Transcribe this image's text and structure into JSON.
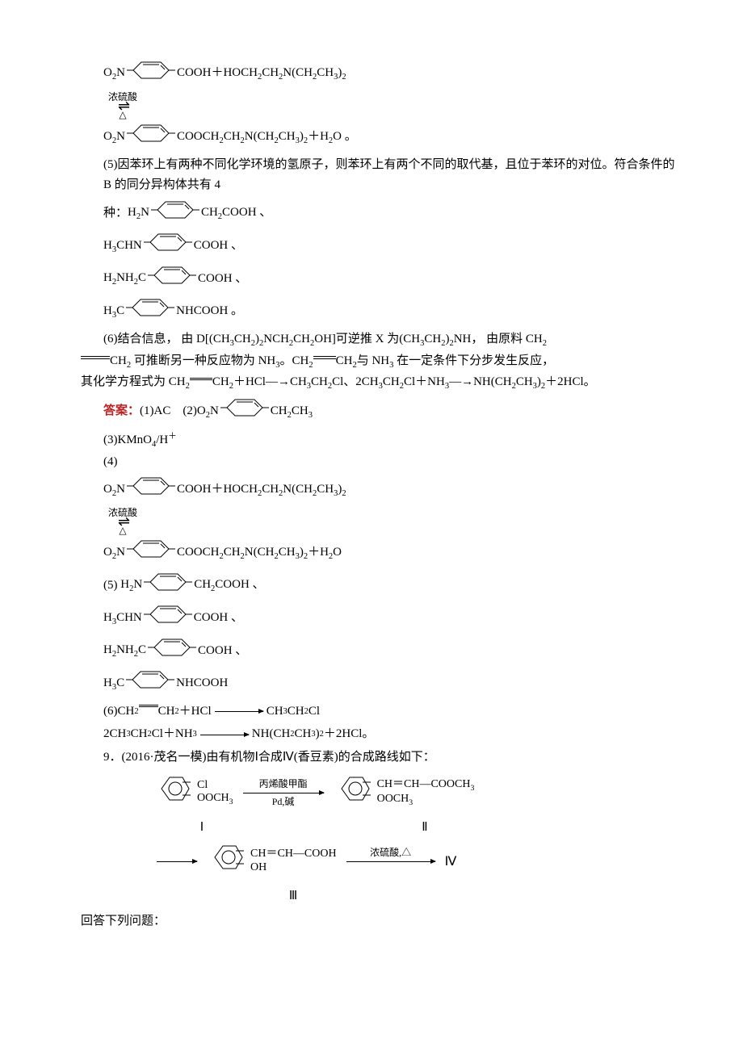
{
  "eq_top": {
    "lhs_a": "O",
    "lhs_b": "N",
    "rhs": "COOH＋HOCH",
    "rhs2": "CH",
    "rhs3": "N(CH",
    "rhs4": "CH",
    "rhs5": ")",
    "cond_top": "浓硫酸",
    "cond_bot": "△",
    "prod_a": "O",
    "prod_b": "N",
    "prod_rhs": "COOCH",
    "prod_rhs2": "CH",
    "prod_rhs3": "N(CH",
    "prod_rhs4": "CH",
    "prod_rhs5": ")",
    "prod_tail": "＋H",
    "prod_tail2": "O  。"
  },
  "p5": "(5)因苯环上有两种不同化学环境的氢原子，则苯环上有两个不同的取代基，且位于苯环的对位。符合条件的 B 的同分异构体共有 4",
  "p5_list_intro": "种：",
  "iso": {
    "a_l": "H",
    "a_l2": "N",
    "a_r": "CH",
    "a_r2": "COOH  、",
    "b_l": "H",
    "b_l2": "CHN",
    "b_r": "COOH  、",
    "c_l": "H",
    "c_l2": "NH",
    "c_l3": "C",
    "c_r": "COOH  、",
    "d_l": "H",
    "d_l2": "C",
    "d_r": "NHCOOH  。"
  },
  "p6a": "(6)结合信息， 由 D[(CH",
  "p6b": "CH",
  "p6c": ")",
  "p6d": "NCH",
  "p6e": "CH",
  "p6f": "OH]可逆推 X 为(CH",
  "p6g": "CH",
  "p6h": ")",
  "p6i": "NH， 由原料 CH",
  "p6j": "CH",
  "p6k": "可推断另一种反应物为 NH",
  "p6l": "。CH",
  "p6m": "CH",
  "p6n": "与 NH",
  "p6o": " 在一定条件下分步发生反应，",
  "p6p": "其化学方程式为 CH",
  "p6q": "CH",
  "p6r": "＋HCl―→CH",
  "p6s": "CH",
  "p6t": "Cl、2CH",
  "p6u": "CH",
  "p6v": "Cl＋NH",
  "p6w": "―→NH(CH",
  "p6x": "CH",
  "p6y": ")",
  "p6z": "＋2HCl。",
  "ans_label": "答案：",
  "ans1": "(1)AC　(2)",
  "ans2_l": "O",
  "ans2_l2": "N",
  "ans2_r": "CH",
  "ans2_r2": "CH",
  "ans3": "(3)KMnO",
  "ans3b": "/H",
  "ans4": "(4)",
  "ans5": "(5)",
  "ans5_iso": {
    "a_l": "H",
    "a_l2": "N",
    "a_r": "CH",
    "a_r2": "COOH  、",
    "b_l": "H",
    "b_l2": "CHN",
    "b_r": "COOH  、",
    "c_l": "H",
    "c_l2": "NH",
    "c_l3": "C",
    "c_r": "COOH  、",
    "d_l": "H",
    "d_l2": "C",
    "d_r": "NHCOOH"
  },
  "ans6a": "(6)CH",
  "ans6b": "CH",
  "ans6c": "＋HCl",
  "ans6d": "CH",
  "ans6e": "CH",
  "ans6f": "Cl",
  "ans6g": "2CH",
  "ans6h": "CH",
  "ans6i": "Cl＋NH",
  "ans6j": "NH(CH",
  "ans6k": "CH",
  "ans6l": ")",
  "ans6m": "＋2HCl。",
  "q9": "9．(2016·茂名一模)由有机物Ⅰ合成Ⅳ(香豆素)的合成路线如下：",
  "scheme": {
    "I_top": "Cl",
    "I_bot": "OOCH",
    "arr1_top": "丙烯酸甲酯",
    "arr1_bot": "Pd,碱",
    "II_top": "CH＝CH—COOCH",
    "II_bot": "OOCH",
    "label_I": "Ⅰ",
    "label_II": "Ⅱ",
    "III_top": "CH＝CH—COOH",
    "III_bot": "OH",
    "arr3": "浓硫酸,△",
    "label_III": "Ⅲ",
    "label_IV": "Ⅳ"
  },
  "closing": "回答下列问题："
}
